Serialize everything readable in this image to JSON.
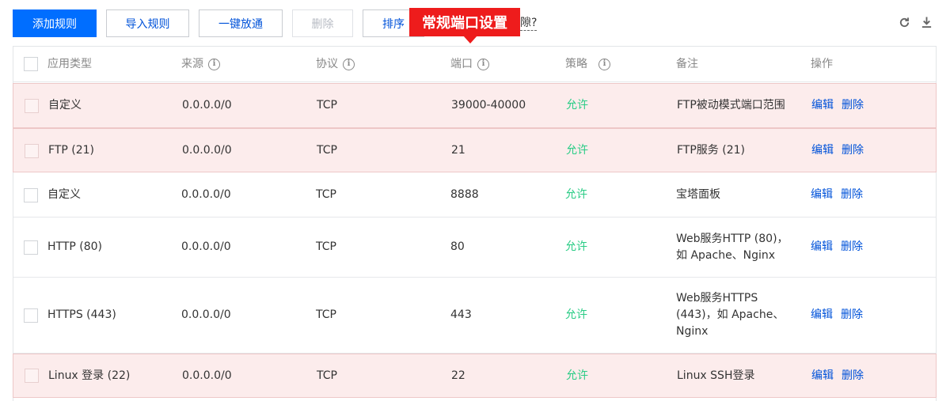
{
  "toolbar": {
    "add_label": "添加规则",
    "import_label": "导入规则",
    "onekey_label": "一键放通",
    "delete_label": "删除",
    "sort_label": "排序",
    "help_link_fragment": "隙?"
  },
  "callout": {
    "text": "常规端口设置"
  },
  "right_icons": [
    "refresh-icon",
    "download-icon"
  ],
  "colors": {
    "primary": "#006eff",
    "link": "#0052d9",
    "allow": "#29cc85",
    "highlight_bg": "#fcecec",
    "callout_bg": "#ee1c1c"
  },
  "table": {
    "headers": {
      "type": "应用类型",
      "source": "来源",
      "protocol": "协议",
      "port": "端口",
      "policy": "策略",
      "note": "备注",
      "action": "操作"
    },
    "rows": [
      {
        "type": "自定义",
        "source": "0.0.0.0/0",
        "protocol": "TCP",
        "port": "39000-40000",
        "policy": "允许",
        "note": "FTP被动模式端口范围",
        "edit": "编辑",
        "delete": "删除",
        "highlighted": true
      },
      {
        "type": "FTP (21)",
        "source": "0.0.0.0/0",
        "protocol": "TCP",
        "port": "21",
        "policy": "允许",
        "note": "FTP服务 (21)",
        "edit": "编辑",
        "delete": "删除",
        "highlighted": true
      },
      {
        "type": "自定义",
        "source": "0.0.0.0/0",
        "protocol": "TCP",
        "port": "8888",
        "policy": "允许",
        "note": "宝塔面板",
        "edit": "编辑",
        "delete": "删除",
        "highlighted": false
      },
      {
        "type": "HTTP (80)",
        "source": "0.0.0.0/0",
        "protocol": "TCP",
        "port": "80",
        "policy": "允许",
        "note_lines": [
          "Web服务HTTP (80)，",
          "如 Apache、Nginx"
        ],
        "edit": "编辑",
        "delete": "删除",
        "highlighted": false
      },
      {
        "type": "HTTPS (443)",
        "source": "0.0.0.0/0",
        "protocol": "TCP",
        "port": "443",
        "policy": "允许",
        "note_lines": [
          "Web服务HTTPS",
          "(443)，如 Apache、",
          "Nginx"
        ],
        "edit": "编辑",
        "delete": "删除",
        "highlighted": false
      },
      {
        "type": "Linux 登录 (22)",
        "source": "0.0.0.0/0",
        "protocol": "TCP",
        "port": "22",
        "policy": "允许",
        "note": "Linux SSH登录",
        "edit": "编辑",
        "delete": "删除",
        "highlighted": true
      }
    ]
  }
}
